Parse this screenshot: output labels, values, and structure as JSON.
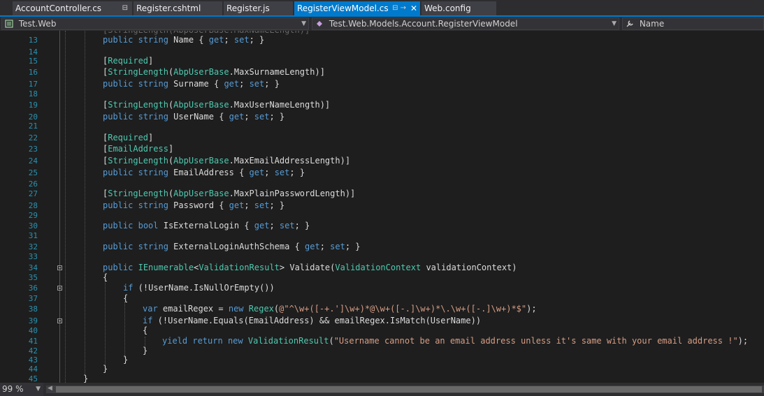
{
  "tabs": [
    {
      "label": "AccountController.cs",
      "pin": "⊟"
    },
    {
      "label": "Register.cshtml"
    },
    {
      "label": "Register.js"
    },
    {
      "label": "RegisterViewModel.cs",
      "pin": "⊟ →",
      "close": "✕",
      "active": true
    },
    {
      "label": "Web.config"
    }
  ],
  "nav": {
    "project": "Test.Web",
    "class": "Test.Web.Models.Account.RegisterViewModel",
    "member": "Name"
  },
  "status": {
    "zoom": "99 %"
  },
  "colors": {
    "accent": "#007acc",
    "keyword": "#569cd6",
    "type": "#4ec9b0",
    "string": "#d69d85",
    "linenum": "#2b91af"
  },
  "lines": [
    {
      "n": "13",
      "code": "public string Name { get; set; }"
    },
    {
      "n": "14",
      "code": ""
    },
    {
      "n": "15",
      "code": "[Required]"
    },
    {
      "n": "16",
      "code": "[StringLength(AbpUserBase.MaxSurnameLength)]"
    },
    {
      "n": "17",
      "code": "public string Surname { get; set; }"
    },
    {
      "n": "18",
      "code": ""
    },
    {
      "n": "19",
      "code": "[StringLength(AbpUserBase.MaxUserNameLength)]"
    },
    {
      "n": "20",
      "code": "public string UserName { get; set; }"
    },
    {
      "n": "21",
      "code": ""
    },
    {
      "n": "22",
      "code": "[Required]"
    },
    {
      "n": "23",
      "code": "[EmailAddress]"
    },
    {
      "n": "24",
      "code": "[StringLength(AbpUserBase.MaxEmailAddressLength)]"
    },
    {
      "n": "25",
      "code": "public string EmailAddress { get; set; }"
    },
    {
      "n": "26",
      "code": ""
    },
    {
      "n": "27",
      "code": "[StringLength(AbpUserBase.MaxPlainPasswordLength)]"
    },
    {
      "n": "28",
      "code": "public string Password { get; set; }"
    },
    {
      "n": "29",
      "code": ""
    },
    {
      "n": "30",
      "code": "public bool IsExternalLogin { get; set; }"
    },
    {
      "n": "31",
      "code": ""
    },
    {
      "n": "32",
      "code": "public string ExternalLoginAuthSchema { get; set; }"
    },
    {
      "n": "33",
      "code": ""
    },
    {
      "n": "34",
      "code": "public IEnumerable<ValidationResult> Validate(ValidationContext validationContext)"
    },
    {
      "n": "35",
      "code": "{"
    },
    {
      "n": "36",
      "code": "if (!UserName.IsNullOrEmpty())"
    },
    {
      "n": "37",
      "code": "{"
    },
    {
      "n": "38",
      "code": "var emailRegex = new Regex(@\"^\\w+([-+.']\\w+)*@\\w+([-.]\\w+)*\\.\\w+([-.]\\w+)*$\");"
    },
    {
      "n": "39",
      "code": "if (!UserName.Equals(EmailAddress) && emailRegex.IsMatch(UserName))"
    },
    {
      "n": "40",
      "code": "{"
    },
    {
      "n": "41",
      "code": "yield return new ValidationResult(\"Username cannot be an email address unless it's same with your email address !\");"
    },
    {
      "n": "42",
      "code": "}"
    },
    {
      "n": "43",
      "code": "}"
    },
    {
      "n": "44",
      "code": "}"
    },
    {
      "n": "45",
      "code": "}"
    }
  ]
}
